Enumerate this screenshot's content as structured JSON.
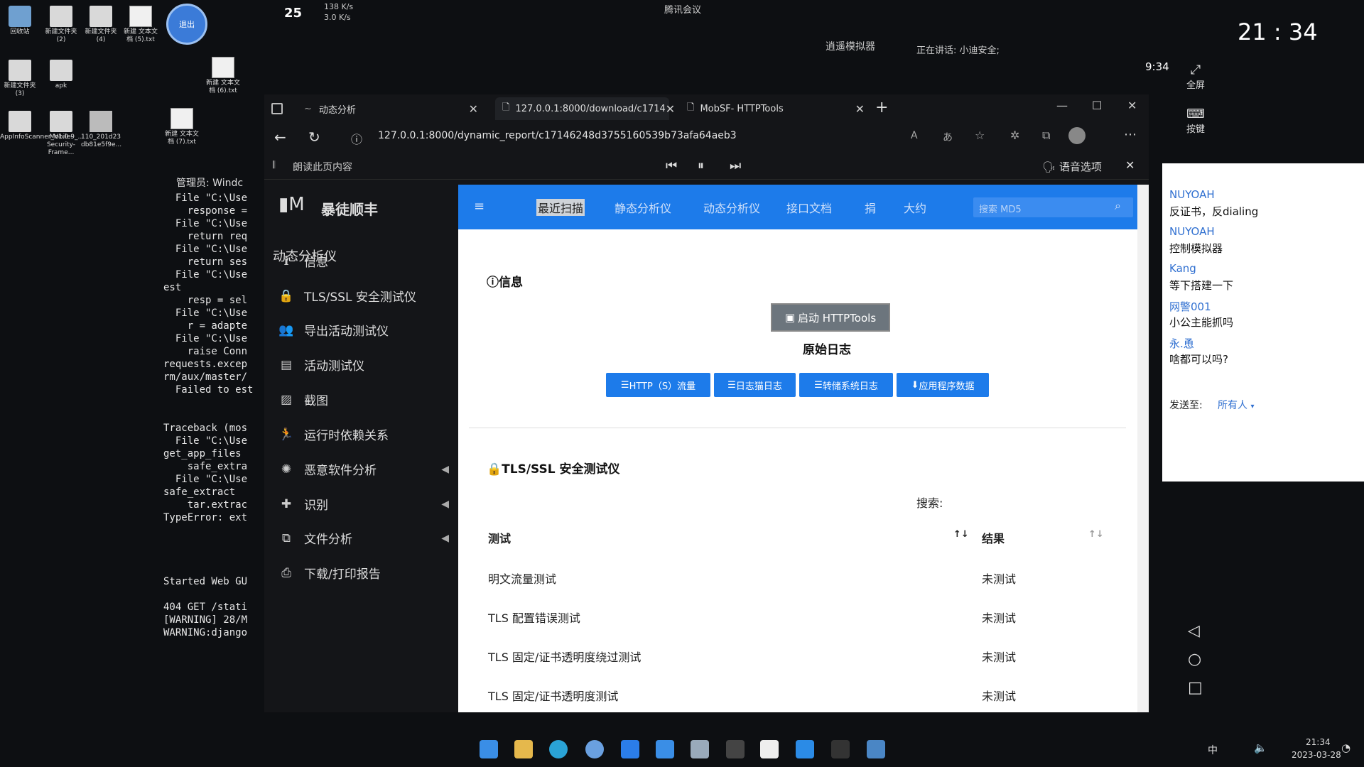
{
  "desktop": {
    "icons": [
      {
        "label": "回收站"
      },
      {
        "label": "新建文件夹 (2)"
      },
      {
        "label": "新建文件夹 (4)"
      },
      {
        "label": "新建 文本文档 (5).txt"
      },
      {
        "label": "新建文件夹 (3)"
      },
      {
        "label": "apk"
      },
      {
        "label": "新建 文本文档 (6).txt"
      },
      {
        "label": "AppInfoScanner_V1.0.9_..."
      },
      {
        "label": "Mobile-Security-Frame..."
      },
      {
        "label": "110_201d23 db81e5f9e..."
      },
      {
        "label": "新建 文本文档 (7).txt"
      }
    ],
    "avatar_text": "退出"
  },
  "status_top": {
    "temperature": "25",
    "net_up": "138 K/s",
    "net_down": "3.0 K/s",
    "meeting": "腾讯会议",
    "emulator": "逍遥模拟器",
    "speaking": "正在讲话: 小迪安全;",
    "phone_time": "9:34",
    "clock": "21 : 34",
    "fullscreen": "全屏",
    "keys": "按键"
  },
  "terminal": {
    "title": "管理员: Windc",
    "lines": [
      "  File \"C:\\Use",
      "    response =",
      "  File \"C:\\Use",
      "    return req",
      "  File \"C:\\Use",
      "    return ses",
      "  File \"C:\\Use",
      "est",
      "    resp = sel",
      "  File \"C:\\Use",
      "    r = adapte",
      "  File \"C:\\Use",
      "    raise Conn",
      "requests.excep",
      "rm/aux/master/",
      "  Failed to est",
      "",
      "",
      "Traceback (mos",
      "  File \"C:\\Use",
      "get_app_files",
      "    safe_extra",
      "  File \"C:\\Use",
      "safe_extract",
      "    tar.extrac",
      "TypeError: ext",
      "",
      "",
      "",
      "",
      "Started Web GU",
      "",
      "404 GET /stati",
      "[WARNING] 28/M",
      "WARNING:django"
    ]
  },
  "browser": {
    "tabs": [
      {
        "label": "动态分析"
      },
      {
        "label": "127.0.0.1:8000/download/c1714"
      },
      {
        "label": "MobSF- HTTPTools"
      }
    ],
    "url": "127.0.0.1:8000/dynamic_report/c17146248d3755160539b73afa64aeb3",
    "read_aloud": "朗读此页内容",
    "voice_options": "语音选项"
  },
  "mobsf": {
    "brand": "暴徒顺丰",
    "page_title": "动态分析仪",
    "sidebar": [
      {
        "label": "信息",
        "icon": "info-icon"
      },
      {
        "label": "TLS/SSL 安全测试仪",
        "icon": "lock-icon"
      },
      {
        "label": "导出活动测试仪",
        "icon": "users-icon"
      },
      {
        "label": "活动测试仪",
        "icon": "id-card-icon"
      },
      {
        "label": "截图",
        "icon": "image-icon"
      },
      {
        "label": "运行时依赖关系",
        "icon": "runner-icon"
      },
      {
        "label": "恶意软件分析",
        "icon": "virus-icon"
      },
      {
        "label": "识别",
        "icon": "plus-icon"
      },
      {
        "label": "文件分析",
        "icon": "copy-icon"
      },
      {
        "label": "下载/打印报告",
        "icon": "print-icon"
      }
    ],
    "nav": {
      "items": [
        "最近扫描",
        "静态分析仪",
        "动态分析仪",
        "接口文档",
        "捐",
        "大约"
      ],
      "search_placeholder": "搜索 MD5"
    },
    "info": {
      "title": "信息",
      "start_button": "启动 HTTPTools",
      "raw_logs": "原始日志",
      "buttons": [
        "HTTP（S）流量",
        "日志猫日志",
        "转储系统日志",
        "应用程序数据"
      ]
    },
    "tls": {
      "title": "TLS/SSL 安全测试仪",
      "search_label": "搜索:",
      "col_test": "测试",
      "col_result": "结果",
      "rows": [
        {
          "test": "明文流量测试",
          "result": "未测试"
        },
        {
          "test": "TLS 配置错误测试",
          "result": "未测试"
        },
        {
          "test": "TLS 固定/证书透明度绕过测试",
          "result": "未测试"
        },
        {
          "test": "TLS 固定/证书透明度测试",
          "result": "未测试"
        }
      ]
    }
  },
  "chat": {
    "messages": [
      {
        "name": "NUYOAH",
        "text": "反证书，反dialing"
      },
      {
        "name": "NUYOAH",
        "text": "控制模拟器"
      },
      {
        "name": "Kang",
        "text": "等下搭建一下"
      },
      {
        "name": "网警001",
        "text": "小公主能抓吗"
      },
      {
        "name": "永.恿",
        "text": "啥都可以吗?"
      }
    ],
    "send_to_label": "发送至:",
    "send_to_value": "所有人"
  },
  "taskbar": {
    "time": "21:34",
    "date": "2023-03-28",
    "ime": "中"
  }
}
